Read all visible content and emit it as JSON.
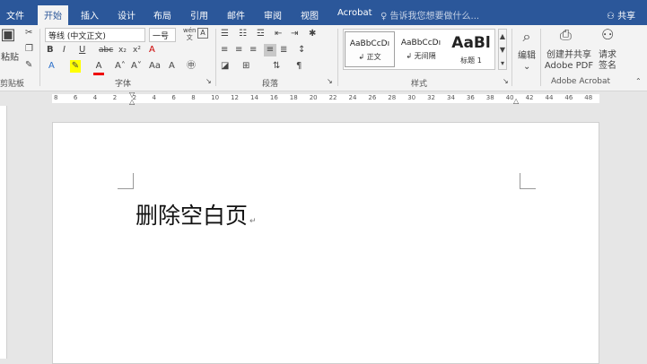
{
  "tabs": [
    "文件",
    "开始",
    "插入",
    "设计",
    "布局",
    "引用",
    "邮件",
    "审阅",
    "视图",
    "Acrobat"
  ],
  "active_tab": "开始",
  "tell_me": "告诉我您想要做什么...",
  "share": "共享",
  "clipboard": {
    "paste": "粘贴",
    "label": "剪贴板"
  },
  "font": {
    "name": "等线 (中文正文)",
    "size": "一号",
    "label": "字体",
    "wen": "wén",
    "wen_char": "文",
    "bold": "B",
    "italic": "I",
    "underline": "U",
    "strike": "abc",
    "sub": "x₂",
    "sup": "x²",
    "clear": "A",
    "grow": "A˄",
    "shrink": "A˅",
    "aa": "Aa"
  },
  "paragraph": {
    "label": "段落"
  },
  "styles": {
    "label": "样式",
    "items": [
      {
        "sample": "AaBbCcDı",
        "name": "正文",
        "mark": "↲"
      },
      {
        "sample": "AaBbCcDı",
        "name": "无间隔",
        "mark": "↲"
      },
      {
        "sample": "AaBl",
        "name": "标题 1",
        "mark": ""
      }
    ]
  },
  "editing": {
    "label": "编辑"
  },
  "acrobat": {
    "create": "创建并共享",
    "create2": "Adobe PDF",
    "sign": "请求",
    "sign2": "签名",
    "label": "Adobe Acrobat"
  },
  "ruler": [
    "8",
    "6",
    "4",
    "2",
    "2",
    "4",
    "6",
    "8",
    "10",
    "12",
    "14",
    "16",
    "18",
    "20",
    "22",
    "24",
    "26",
    "28",
    "30",
    "32",
    "34",
    "36",
    "38",
    "40",
    "42",
    "44",
    "46",
    "48"
  ],
  "document": {
    "text": "删除空白页",
    "mark": "↵"
  },
  "colors": {
    "tabbar": "#2b579a",
    "ribbon": "#f3f3f3",
    "page": "#ffffff"
  }
}
